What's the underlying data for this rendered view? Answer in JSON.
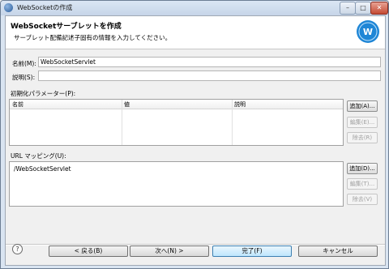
{
  "window": {
    "title": "WebSocketの作成",
    "buttons": {
      "minimize": "–",
      "maximize": "□",
      "close": "✕"
    }
  },
  "banner": {
    "title": "WebSocketサーブレットを作成",
    "description": "サーブレット配備記述子固有の情報を入力してください。",
    "logo_icon": "websocket-logo-icon"
  },
  "form": {
    "name_label": "名前(M):",
    "name_value": "WebSocketServlet",
    "description_label": "説明(S):",
    "description_value": ""
  },
  "init_params": {
    "label": "初期化パラメーター(P):",
    "columns": [
      "名前",
      "値",
      "説明"
    ],
    "rows": [],
    "buttons": {
      "add": "追加(A)...",
      "edit": "編集(E)...",
      "remove": "除去(R)"
    }
  },
  "url_mappings": {
    "label": "URL マッピング(U):",
    "items": [
      "/WebSocketServlet"
    ],
    "buttons": {
      "add": "追加(D)...",
      "edit": "編集(T)...",
      "remove": "除去(V)"
    }
  },
  "footer": {
    "help_icon": "?",
    "back": "< 戻る(B)",
    "next": "次へ(N) >",
    "finish": "完了(F)",
    "cancel": "キャンセル"
  },
  "colors": {
    "accent": "#3c7fb1",
    "logo": "#1f86d6"
  }
}
